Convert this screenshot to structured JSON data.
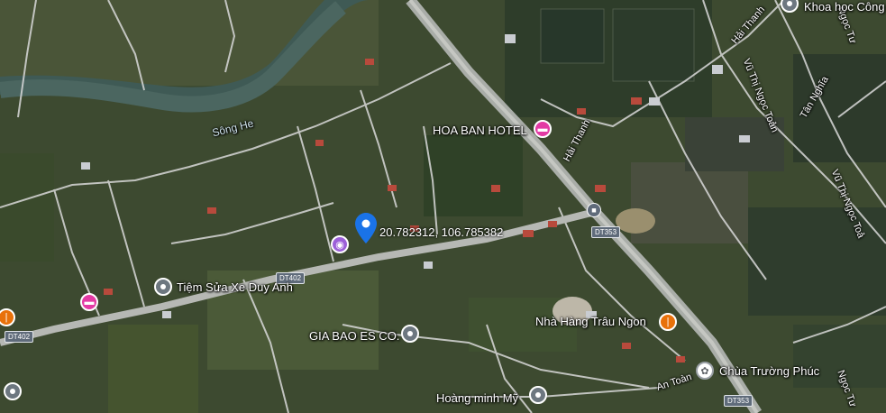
{
  "map": {
    "view": "satellite"
  },
  "places": {
    "khoa_hoc": "Khoa học Công",
    "hoa_ban_hotel": "HOA BAN HOTEL",
    "tiem_sua_xe": "Tiệm Sửa Xe Duy Anh",
    "gia_bao": "GIA BAO ES CO.",
    "nha_hang": "Nhà Hàng Trâu Ngon",
    "chua": "Chùa Trường Phúc",
    "hoang_minh": "Hoàng minh Mỹ"
  },
  "water": {
    "river": "Sông He"
  },
  "roads": {
    "hai_thanh_1": "Hải Thanh",
    "hai_thanh_2": "Hải Thanh",
    "vu_thi_ngoc_toan_1": "Vũ Thị Ngọc Toản",
    "vu_thi_ngoc_toan_2": "Vũ Thị Ngọc Toả",
    "tan_nghia": "Tân Nghĩa",
    "an_toan": "An Toàn",
    "ngoc_tu": "Ngọc Tư",
    "dt402_a": "DT402",
    "dt402_b": "DT402",
    "dt353_a": "DT353",
    "dt353_b": "DT353"
  },
  "dropped_pin": {
    "coordinates": "20.782312, 106.785382"
  },
  "colors": {
    "hotel": "#e33aa4",
    "restaurant": "#e8710a",
    "generic": "#6d7780",
    "pin": "#1a73e8"
  },
  "icons": {
    "hotel": "bed-icon",
    "restaurant": "fork-knife-icon",
    "temple": "temple-icon",
    "transit": "bus-icon",
    "poi": "place-icon",
    "dropped_pin": "location-pin-icon"
  }
}
